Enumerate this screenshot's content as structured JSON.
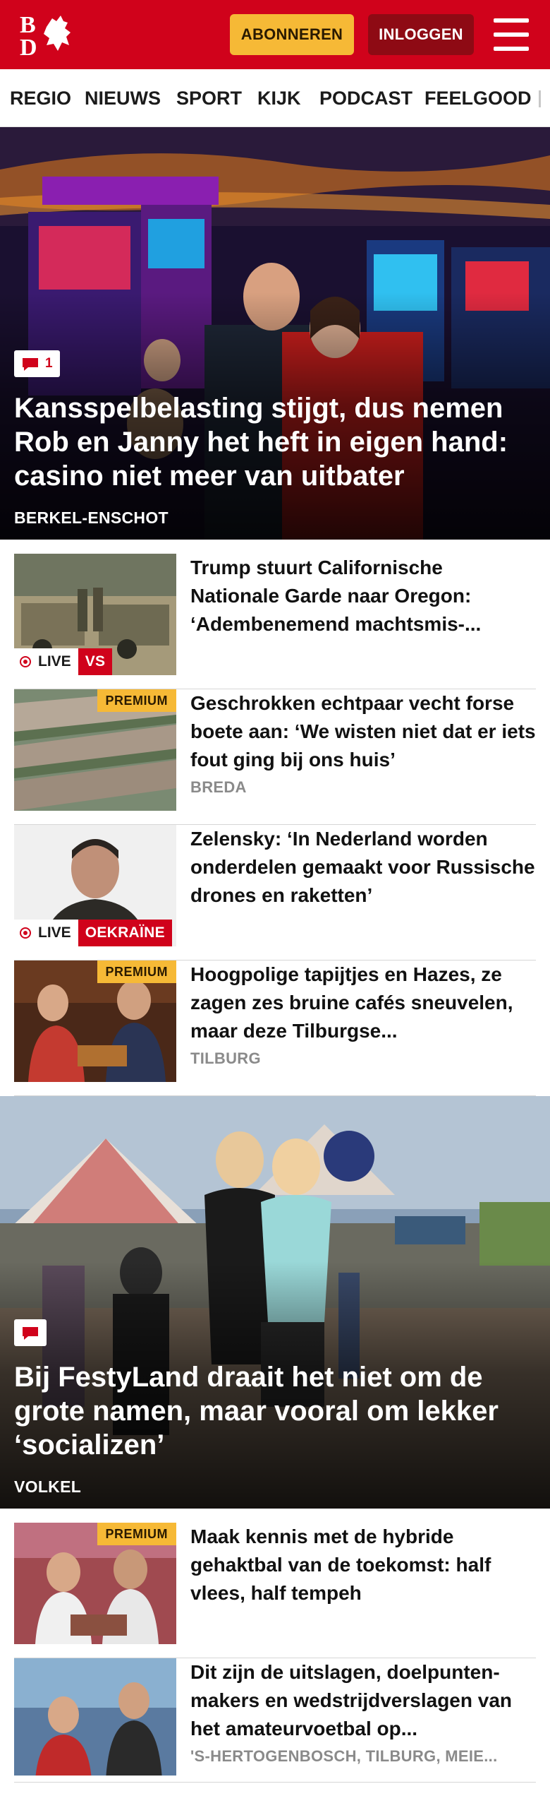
{
  "header": {
    "logo_text": "BD",
    "subscribe_label": "ABONNEREN",
    "login_label": "INLOGGEN",
    "brand_color": "#d0021b",
    "accent_color": "#f6b936"
  },
  "nav": {
    "items": [
      "REGIO",
      "NIEUWS",
      "SPORT",
      "KIJK",
      "PODCAST",
      "FEELGOOD"
    ]
  },
  "hero1": {
    "comment_count": "1",
    "title": "Kansspelbelasting stijgt, dus nemen Rob en Janny het heft in eigen hand: casino niet meer van uitbater",
    "location": "BERKEL-ENSCHOT"
  },
  "list1": [
    {
      "title": "Trump stuurt Californische Nationale Garde naar Oregon: ‘Adembenemend machtsmis-...",
      "live": "LIVE",
      "topic": "VS"
    },
    {
      "title": "Geschrokken echtpaar vecht forse boete aan: ‘We wisten niet dat er iets fout ging bij ons huis’",
      "premium": "PREMIUM",
      "location": "BREDA"
    },
    {
      "title": "Zelensky: ‘In Nederland worden onderdelen gemaakt voor Russische drones en raketten’",
      "live": "LIVE",
      "topic": "OEKRAÏNE"
    },
    {
      "title": "Hoogpolige tapijtjes en Hazes, ze zagen zes bruine cafés sneuvelen, maar deze Tilburgse...",
      "premium": "PREMIUM",
      "location": "TILBURG"
    }
  ],
  "hero2": {
    "title": "Bij FestyLand draait het niet om de grote namen, maar vooral om lekker ‘socializen’",
    "location": "VOLKEL"
  },
  "list2": [
    {
      "title": "Maak kennis met de hybride gehaktbal van de toekomst: half vlees, half tempeh",
      "premium": "PREMIUM"
    },
    {
      "title": "Dit zijn de uitslagen, doelpunten-makers en wedstrijdverslagen van het amateurvoetbal op...",
      "location": "'S-HERTOGENBOSCH, TILBURG, MEIE..."
    }
  ]
}
